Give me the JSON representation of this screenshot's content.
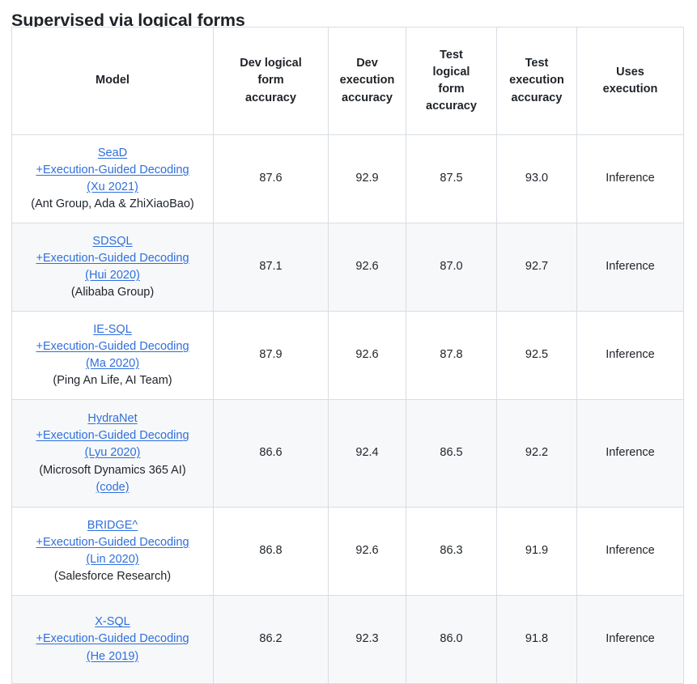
{
  "section": {
    "heading": "Supervised via logical forms"
  },
  "table": {
    "columns": [
      {
        "id": "model",
        "lines": [
          "Model"
        ]
      },
      {
        "id": "dev_lf",
        "lines": [
          "Dev logical",
          "form",
          "accuracy"
        ]
      },
      {
        "id": "dev_ex",
        "lines": [
          "Dev",
          "execution",
          "accuracy"
        ]
      },
      {
        "id": "test_lf",
        "lines": [
          "Test",
          "logical",
          "form",
          "accuracy"
        ]
      },
      {
        "id": "test_ex",
        "lines": [
          "Test",
          "execution",
          "accuracy"
        ]
      },
      {
        "id": "uses_ex",
        "lines": [
          "Uses",
          "execution"
        ]
      }
    ],
    "rows": [
      {
        "model_lines": [
          {
            "text": "SeaD",
            "link": true
          },
          {
            "text": "+Execution-Guided Decoding",
            "link": true
          },
          {
            "text": "(Xu 2021)",
            "link": true
          },
          {
            "text": "(Ant Group, Ada & ZhiXiaoBao)",
            "link": false
          }
        ],
        "dev_lf": "87.6",
        "dev_ex": "92.9",
        "test_lf": "87.5",
        "test_ex": "93.0",
        "uses_ex": "Inference"
      },
      {
        "model_lines": [
          {
            "text": "SDSQL",
            "link": true
          },
          {
            "text": "+Execution-Guided Decoding",
            "link": true
          },
          {
            "text": "(Hui 2020)",
            "link": true
          },
          {
            "text": "(Alibaba Group)",
            "link": false
          }
        ],
        "dev_lf": "87.1",
        "dev_ex": "92.6",
        "test_lf": "87.0",
        "test_ex": "92.7",
        "uses_ex": "Inference"
      },
      {
        "model_lines": [
          {
            "text": "IE-SQL",
            "link": true
          },
          {
            "text": "+Execution-Guided Decoding",
            "link": true
          },
          {
            "text": "(Ma 2020)",
            "link": true
          },
          {
            "text": "(Ping An Life, AI Team)",
            "link": false
          }
        ],
        "dev_lf": "87.9",
        "dev_ex": "92.6",
        "test_lf": "87.8",
        "test_ex": "92.5",
        "uses_ex": "Inference"
      },
      {
        "model_lines": [
          {
            "text": "HydraNet",
            "link": true
          },
          {
            "text": "+Execution-Guided Decoding",
            "link": true
          },
          {
            "text": "(Lyu 2020)",
            "link": true
          },
          {
            "text": "(Microsoft Dynamics 365 AI)",
            "link": false
          },
          {
            "text": "(code)",
            "link": true
          }
        ],
        "dev_lf": "86.6",
        "dev_ex": "92.4",
        "test_lf": "86.5",
        "test_ex": "92.2",
        "uses_ex": "Inference"
      },
      {
        "model_lines": [
          {
            "text": "BRIDGE^",
            "link": true
          },
          {
            "text": "+Execution-Guided Decoding",
            "link": true
          },
          {
            "text": "(Lin 2020)",
            "link": true
          },
          {
            "text": "(Salesforce Research)",
            "link": false
          }
        ],
        "dev_lf": "86.8",
        "dev_ex": "92.6",
        "test_lf": "86.3",
        "test_ex": "91.9",
        "uses_ex": "Inference"
      },
      {
        "model_lines": [
          {
            "text": "X-SQL",
            "link": true
          },
          {
            "text": "+Execution-Guided Decoding",
            "link": true
          },
          {
            "text": "(He 2019)",
            "link": true
          }
        ],
        "dev_lf": "86.2",
        "dev_ex": "92.3",
        "test_lf": "86.0",
        "test_ex": "91.8",
        "uses_ex": "Inference"
      }
    ]
  },
  "colors": {
    "link": "#2f6fdb",
    "text": "#1f2328",
    "border": "#d8dde3",
    "stripe": "#f6f8fa",
    "background": "#ffffff"
  }
}
